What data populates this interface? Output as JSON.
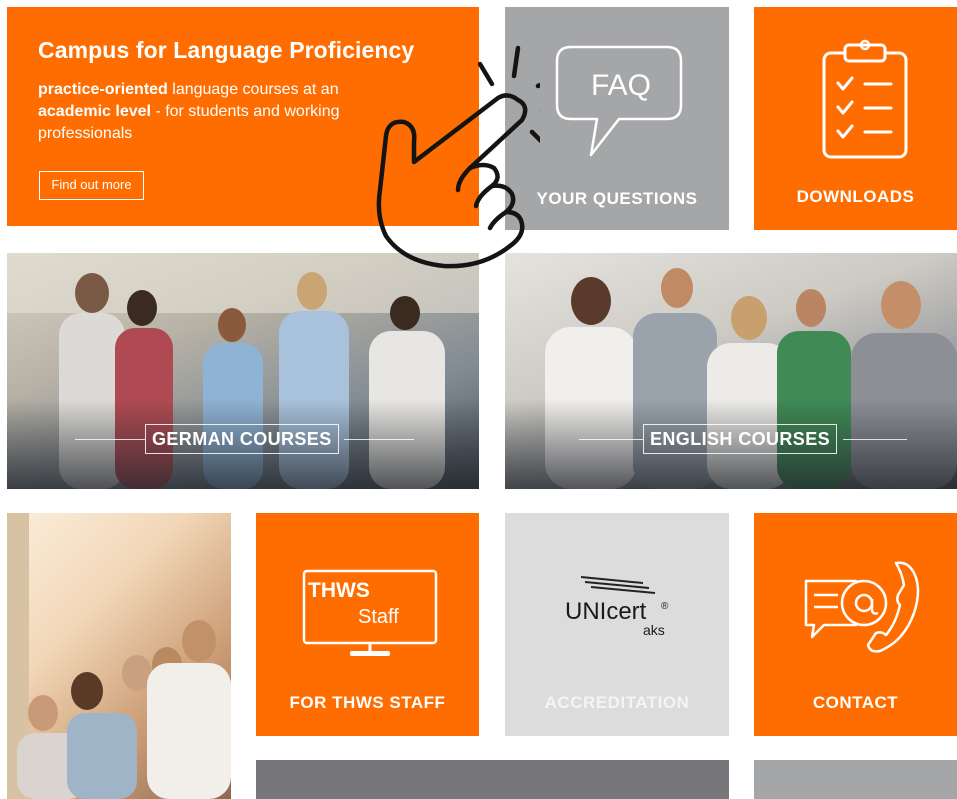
{
  "hero": {
    "title": "Campus for Language Proficiency",
    "desc_bold1": "practice-oriented",
    "desc_text1": " language courses at an ",
    "desc_bold2": "academic level",
    "desc_text2": " - for students and working professionals",
    "button_label": "Find out more"
  },
  "tiles": {
    "faq": {
      "icon_text": "FAQ",
      "label": "YOUR QUESTIONS"
    },
    "downloads": {
      "label": "DOWNLOADS"
    },
    "german": {
      "label": "GERMAN COURSES"
    },
    "english": {
      "label": "ENGLISH COURSES"
    },
    "staff": {
      "screen_line1": "THWS",
      "screen_line2": "Staff",
      "label": "FOR THWS STAFF"
    },
    "accreditation": {
      "logo_main": "UNIcert",
      "logo_reg": "®",
      "logo_sub": "aks",
      "label": "ACCREDITATION"
    },
    "contact": {
      "label": "CONTACT"
    }
  },
  "colors": {
    "orange": "#ff6d00",
    "grey": "#a5a6a8",
    "light_grey": "#dcdcdc",
    "dark_grey": "#77777b"
  },
  "icons": {
    "faq": "speech-bubble-icon",
    "downloads": "clipboard-checklist-icon",
    "staff": "monitor-icon",
    "contact": "email-phone-icon",
    "pointer": "pointing-hand-icon"
  }
}
